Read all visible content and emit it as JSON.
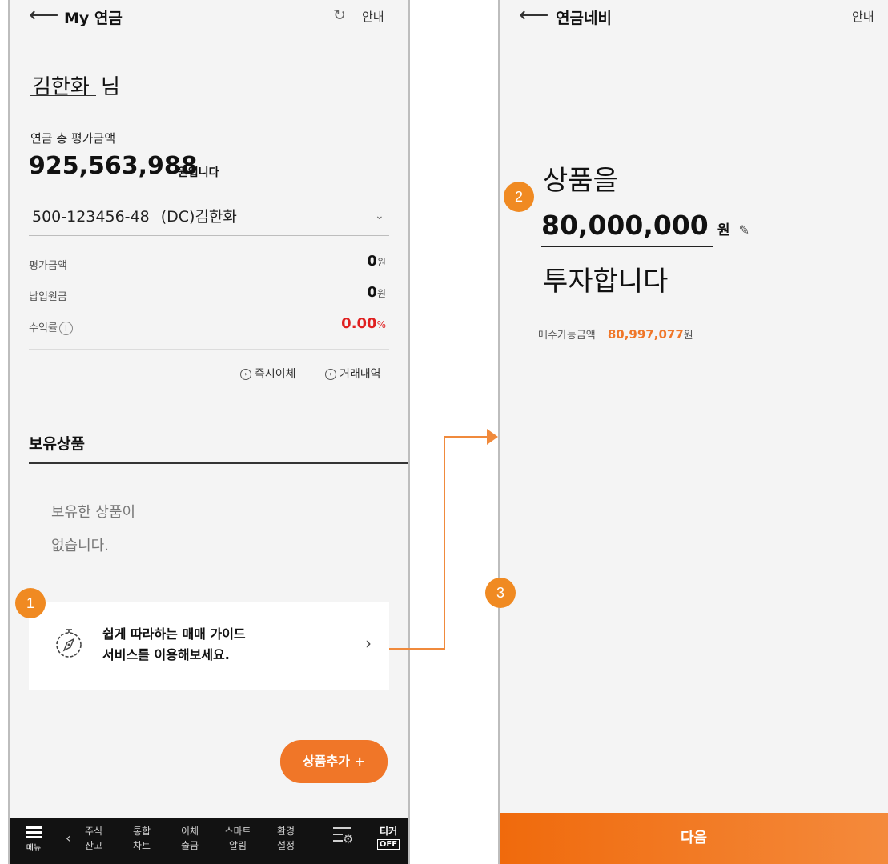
{
  "left": {
    "header": {
      "title": "My 연금",
      "info_label": "안내"
    },
    "greeting": {
      "name": "김한화",
      "suffix": "님"
    },
    "total": {
      "label": "연금 총 평가금액",
      "amount": "925,563,988",
      "unit": "원입니다"
    },
    "account": {
      "number": "500-123456-48",
      "type_name": "(DC)김한화"
    },
    "rows": [
      {
        "label": "평가금액",
        "value": "0",
        "unit": "원"
      },
      {
        "label": "납입원금",
        "value": "0",
        "unit": "원"
      },
      {
        "label": "수익률",
        "value": "0.00",
        "unit": "%"
      }
    ],
    "actions": {
      "transfer": "즉시이체",
      "history": "거래내역"
    },
    "holdings": {
      "title": "보유상품",
      "empty_line1": "보유한 상품이",
      "empty_line2": "없습니다."
    },
    "guide": {
      "line1": "쉽게 따라하는 매매 가이드",
      "line2": "서비스를 이용해보세요."
    },
    "add_button": "상품추가 +",
    "badge": "1",
    "navbar": {
      "menu": "메뉴",
      "items": [
        {
          "top": "주식",
          "bottom": "잔고"
        },
        {
          "top": "통합",
          "bottom": "차트"
        },
        {
          "top": "이체",
          "bottom": "출금"
        },
        {
          "top": "스마트",
          "bottom": "알림"
        },
        {
          "top": "환경",
          "bottom": "설정"
        }
      ],
      "ticker": "티커",
      "ticker_state": "OFF"
    }
  },
  "right": {
    "header": {
      "title": "연금네비",
      "info_label": "안내"
    },
    "line1": "상품을",
    "amount": "80,000,000",
    "amount_unit": "원",
    "line3": "투자합니다",
    "available": {
      "label": "매수가능금액",
      "value": "80,997,077",
      "unit": "원"
    },
    "badge2": "2",
    "badge3": "3",
    "next_button": "다음"
  },
  "colors": {
    "accent": "#f07628",
    "badge": "#f08a22",
    "negative": "#e02020",
    "navbar": "#121212"
  }
}
